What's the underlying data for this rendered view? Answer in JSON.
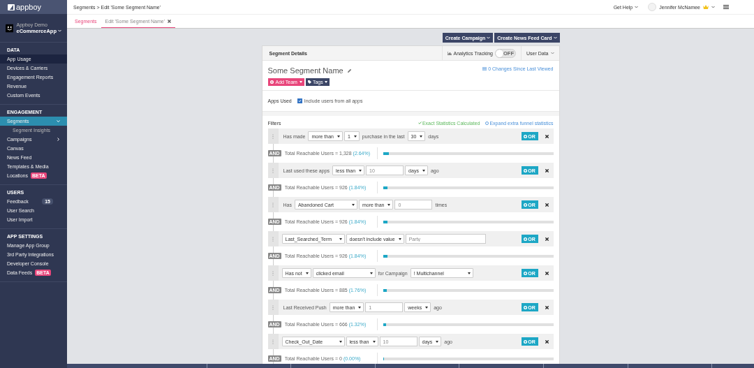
{
  "brand": {
    "name": "appboy"
  },
  "account": {
    "group": "Appboy Demo",
    "app": "eCommerceApp"
  },
  "sidebar": [
    {
      "title": "DATA",
      "items": [
        {
          "label": "App Usage",
          "selected": false,
          "hovered": true
        },
        {
          "label": "Devices & Carriers",
          "selected": false,
          "hovered": false
        },
        {
          "label": "Engagement Reports",
          "selected": false,
          "hovered": false
        },
        {
          "label": "Revenue",
          "selected": false,
          "hovered": false
        },
        {
          "label": "Custom Events",
          "selected": false,
          "hovered": false
        }
      ]
    },
    {
      "title": "ENGAGEMENT",
      "items": [
        {
          "label": "Segments",
          "selected": true,
          "hovered": false,
          "expanded": true,
          "children": [
            {
              "label": "Segment Insights",
              "selected": false
            }
          ]
        },
        {
          "label": "Campaigns",
          "selected": false,
          "hovered": false,
          "expanded": false
        },
        {
          "label": "Canvas",
          "selected": false,
          "hovered": false
        },
        {
          "label": "News Feed",
          "selected": false,
          "hovered": false
        },
        {
          "label": "Templates & Media",
          "selected": false,
          "hovered": false
        },
        {
          "label": "Locations",
          "selected": false,
          "hovered": false,
          "badge": {
            "kind": "beta",
            "text": "BETA"
          }
        }
      ]
    },
    {
      "title": "USERS",
      "items": [
        {
          "label": "Feedback",
          "selected": false,
          "hovered": false,
          "badge": {
            "kind": "count",
            "text": "15"
          }
        },
        {
          "label": "User Search",
          "selected": false,
          "hovered": false
        },
        {
          "label": "User Import",
          "selected": false,
          "hovered": false
        }
      ]
    },
    {
      "title": "APP SETTINGS",
      "items": [
        {
          "label": "Manage App Group",
          "selected": false,
          "hovered": false
        },
        {
          "label": "3rd Party Integrations",
          "selected": false,
          "hovered": false
        },
        {
          "label": "Developer Console",
          "selected": false,
          "hovered": false
        },
        {
          "label": "Data Feeds",
          "selected": false,
          "hovered": false,
          "badge": {
            "kind": "beta",
            "text": "BETA"
          }
        }
      ]
    }
  ],
  "breadcrumb": "Segments > Edit 'Some Segment Name'",
  "top_right": {
    "help": "Get Help",
    "user": "Jennifer McNamee"
  },
  "tabs": [
    {
      "label": "Segments",
      "selected": false,
      "closable": false
    },
    {
      "label": "Edit 'Some Segment Name'",
      "selected": true,
      "closable": true
    }
  ],
  "actions": [
    "Create Campaign",
    "Create News Feed Card"
  ],
  "card": {
    "title": "Segment Details",
    "analytics": {
      "label": "Analytics Tracking",
      "on": false,
      "state_text": "OFF"
    },
    "user_data": "User Data",
    "name": "Some Segment Name",
    "changes": "0 Changes Since Last Viewed",
    "add_team": "Add Team",
    "tags": "Tags",
    "apps_used": {
      "label": "Apps Used",
      "checked": true,
      "text": "Include users from all apps"
    },
    "filters_title": "Filters",
    "exact": "Exact Statistics Calculated",
    "expand": "Expand extra funnel statistics"
  },
  "filters": [
    {
      "parts": [
        {
          "kind": "text",
          "text": "Has made"
        },
        {
          "kind": "select",
          "text": "more than",
          "wide": false
        },
        {
          "kind": "select",
          "text": "1",
          "wide": false
        },
        {
          "kind": "text",
          "text": "purchase in the last"
        },
        {
          "kind": "select",
          "text": "30",
          "wide": false
        },
        {
          "kind": "text",
          "text": "days"
        }
      ],
      "or": "OR",
      "and": "AND",
      "total_label": "Total Reachable Users =",
      "users": "1,328",
      "pct": "(2.64%)",
      "level": 0.0264
    },
    {
      "parts": [
        {
          "kind": "text",
          "text": "Last used these apps"
        },
        {
          "kind": "select",
          "text": "less than",
          "wide": false
        },
        {
          "kind": "input",
          "placeholder": "10",
          "wide": false
        },
        {
          "kind": "select",
          "text": "days",
          "wide": false
        },
        {
          "kind": "text",
          "text": "ago"
        }
      ],
      "or": "OR",
      "and": "AND",
      "total_label": "Total Reachable Users =",
      "users": "926",
      "pct": "(1.84%)",
      "level": 0.0184
    },
    {
      "parts": [
        {
          "kind": "text",
          "text": "Has"
        },
        {
          "kind": "select",
          "text": "Abandoned Cart",
          "wide": true
        },
        {
          "kind": "select",
          "text": "more than",
          "wide": false
        },
        {
          "kind": "input",
          "placeholder": "0",
          "wide": false
        },
        {
          "kind": "text",
          "text": "times"
        }
      ],
      "or": "OR",
      "and": "AND",
      "total_label": "Total Reachable Users =",
      "users": "926",
      "pct": "(1.84%)",
      "level": 0.0184
    },
    {
      "parts": [
        {
          "kind": "select",
          "text": "Last_Searched_Term",
          "wide": true
        },
        {
          "kind": "select",
          "text": "doesn't include value",
          "wide": false
        },
        {
          "kind": "input",
          "placeholder": "Party",
          "wide": true
        }
      ],
      "or": "OR",
      "and": "AND",
      "total_label": "Total Reachable Users =",
      "users": "926",
      "pct": "(1.84%)",
      "level": 0.0184
    },
    {
      "parts": [
        {
          "kind": "select",
          "text": "Has not",
          "wide": false
        },
        {
          "kind": "select",
          "text": "clicked email",
          "wide": true
        },
        {
          "kind": "text",
          "text": "for Campaign"
        },
        {
          "kind": "select",
          "text": "! Multichannel",
          "wide": true
        }
      ],
      "or": "OR",
      "and": "AND",
      "total_label": "Total Reachable Users =",
      "users": "885",
      "pct": "(1.76%)",
      "level": 0.0176
    },
    {
      "parts": [
        {
          "kind": "text",
          "text": "Last Received Push"
        },
        {
          "kind": "select",
          "text": "more than",
          "wide": false
        },
        {
          "kind": "input",
          "placeholder": "1",
          "wide": false
        },
        {
          "kind": "select",
          "text": "weeks",
          "wide": false
        },
        {
          "kind": "text",
          "text": "ago"
        }
      ],
      "or": "OR",
      "and": "AND",
      "total_label": "Total Reachable Users =",
      "users": "666",
      "pct": "(1.32%)",
      "level": 0.0132
    },
    {
      "parts": [
        {
          "kind": "select",
          "text": "Check_Out_Date",
          "wide": true
        },
        {
          "kind": "select",
          "text": "less than",
          "wide": false
        },
        {
          "kind": "input",
          "placeholder": "10",
          "wide": false
        },
        {
          "kind": "select",
          "text": "days",
          "wide": false
        },
        {
          "kind": "text",
          "text": "ago"
        }
      ],
      "or": "OR",
      "and": "AND",
      "total_label": "Total Reachable Users =",
      "users": "0",
      "pct": "(0.00%)",
      "level": 0
    }
  ]
}
